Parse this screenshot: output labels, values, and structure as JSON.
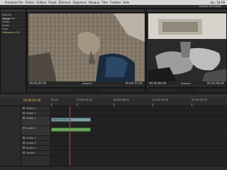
{
  "menubar": {
    "items": [
      "Premiere Pro",
      "Fichier",
      "Edition",
      "Projet",
      "Élément",
      "Séquence",
      "Marque",
      "Titre",
      "Fenêtre",
      "Aide"
    ],
    "clock": "Jeu. 14:56"
  },
  "workspace": {
    "label": "Espace de travail"
  },
  "project": {
    "tabs": [
      "Projet",
      "Bin"
    ],
    "rows": [
      "Dossier",
      "Séquence",
      "Vidéo",
      "Audio",
      "Titre",
      "Fréquence 25"
    ]
  },
  "source": {
    "tabs": [
      "Source",
      "Effets",
      "Mixage"
    ],
    "timecode_left": "00;00;00;00",
    "timecode_right": "00;00;03;00",
    "fit": "Adapter",
    "scale_label": "Pleine"
  },
  "program": {
    "tabs": [
      "Programme : Séquence 01"
    ],
    "timecode_left": "00;00;00;00",
    "timecode_right": "00;00;08;00",
    "fit": "Adapter"
  },
  "timeline": {
    "tabs": [
      "Séquence 01"
    ],
    "timecode": "00;00;01;00",
    "ruler_labels": [
      "00;00",
      "00;00;04;00",
      "00;00;08;00",
      "00;00;16;00",
      "00;00;32;00"
    ],
    "tracks": [
      {
        "name": "Vidéo 3"
      },
      {
        "name": "Vidéo 2"
      },
      {
        "name": "Vidéo 1"
      },
      {
        "name": "Audio 1"
      },
      {
        "name": "Audio 2"
      },
      {
        "name": "Audio 3"
      },
      {
        "name": "Audio 4"
      },
      {
        "name": "Master"
      }
    ],
    "clip_label": "clip01.mov [V]"
  },
  "left_strip": {
    "label": "Effets · Vidéo"
  }
}
